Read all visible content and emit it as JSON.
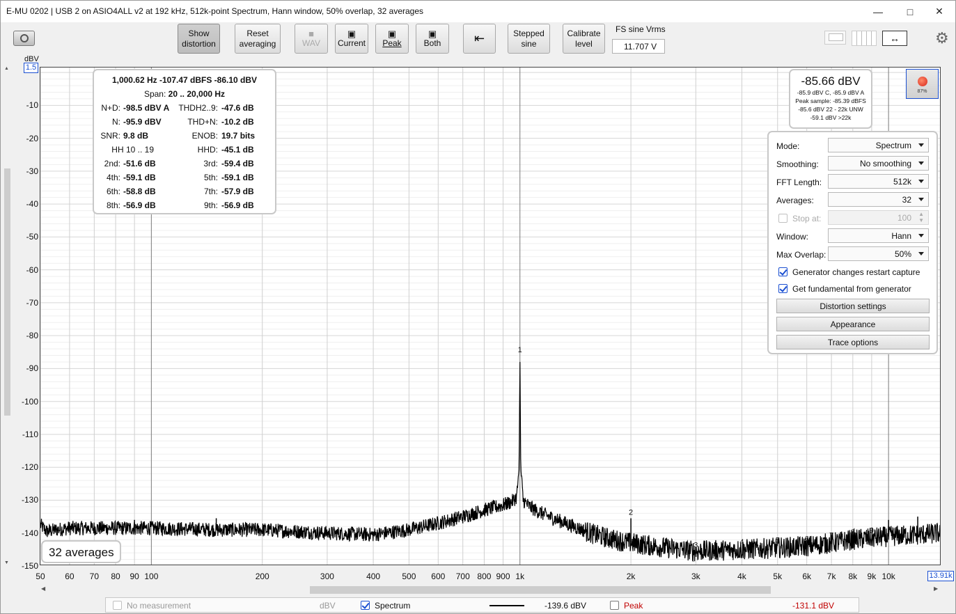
{
  "window": {
    "title": "E-MU 0202 | USB 2 on ASIO4ALL v2 at 192 kHz, 512k-point Spectrum, Hann window, 50% overlap, 32 averages",
    "minimize_icon": "minimize-icon",
    "maximize_icon": "maximize-icon",
    "close_icon": "close-icon"
  },
  "toolbar": {
    "snapshot_icon": "camera-icon",
    "show_distortion": [
      "Show",
      "distortion"
    ],
    "reset_averaging": [
      "Reset",
      "averaging"
    ],
    "wav": "WAV",
    "current": "Current",
    "peak": "Peak",
    "both": "Both",
    "export_icon": "export-arrow-icon",
    "stepped_sine": [
      "Stepped",
      "sine"
    ],
    "calibrate_level": [
      "Calibrate",
      "level"
    ],
    "fs_label": "FS sine Vrms",
    "fs_value": "11.707 V",
    "gear_icon": "gear-icon"
  },
  "plot": {
    "ylabel": "dBV",
    "y_top_value": "1.5",
    "y_ticks": [
      "-10",
      "-20",
      "-30",
      "-40",
      "-50",
      "-60",
      "-70",
      "-80",
      "-90",
      "-100",
      "-110",
      "-120",
      "-130",
      "-140",
      "-150"
    ],
    "x_ticks": [
      "50",
      "60",
      "70",
      "80",
      "90",
      "100",
      "200",
      "300",
      "400",
      "500",
      "600",
      "700",
      "800",
      "900",
      "1k",
      "2k",
      "3k",
      "4k",
      "5k",
      "6k",
      "7k",
      "8k",
      "9k",
      "10k"
    ],
    "x_end_value": "13.91k",
    "averages_badge": "32 averages"
  },
  "chart_data": {
    "type": "line",
    "xlabel": "",
    "ylabel": "dBV",
    "xscale": "log",
    "xlim": [
      50,
      13910
    ],
    "ylim": [
      -150,
      1.5
    ],
    "grid": true,
    "series": [
      {
        "name": "Spectrum",
        "color": "#000000",
        "x": [
          50,
          52,
          55,
          60,
          70,
          80,
          100,
          150,
          200,
          300,
          400,
          500,
          600,
          700,
          800,
          900,
          950,
          980,
          995,
          1000,
          1005,
          1020,
          1050,
          1100,
          1200,
          1400,
          1600,
          1800,
          2000,
          2500,
          3000,
          4000,
          5000,
          6000,
          7000,
          8000,
          9000,
          10000,
          12000,
          13910
        ],
        "y": [
          -137.5,
          -139.5,
          -139,
          -138.5,
          -138.5,
          -138.5,
          -138.5,
          -139,
          -139,
          -140,
          -140.5,
          -139,
          -137,
          -135,
          -133,
          -131.5,
          -130.5,
          -129,
          -120,
          -86.1,
          -120,
          -130,
          -131.5,
          -133,
          -135,
          -138,
          -140.5,
          -142,
          -143,
          -144.5,
          -145.5,
          -145,
          -144.5,
          -144,
          -143,
          -142,
          -141.5,
          -141,
          -140.5,
          -140
        ]
      }
    ],
    "harmonic_markers": [
      {
        "label": "1",
        "x": 1000,
        "y": -86.1
      },
      {
        "label": "2",
        "x": 2000,
        "y": -135.5
      },
      {
        "label": "3",
        "x": 3000,
        "y": -145.5
      },
      {
        "label": "4",
        "x": 4000,
        "y": -144.5
      },
      {
        "label": "5",
        "x": 5000,
        "y": -144
      },
      {
        "label": "6",
        "x": 6000,
        "y": -143.5
      },
      {
        "label": "7",
        "x": 7000,
        "y": -142.5
      },
      {
        "label": "8",
        "x": 8000,
        "y": -141.5
      },
      {
        "label": "9",
        "x": 9000,
        "y": -141
      }
    ],
    "spurs": [
      {
        "x": 90,
        "y": -136
      },
      {
        "x": 150,
        "y": -135.5
      },
      {
        "x": 2000,
        "y": -135.5
      },
      {
        "x": 10000,
        "y": -136
      },
      {
        "x": 12000,
        "y": -135
      }
    ]
  },
  "distortion": {
    "header": "1,000.62 Hz  -107.47 dBFS  -86.10 dBV",
    "span_label": "Span:",
    "span_value": "20 .. 20,000 Hz",
    "rows": [
      {
        "l1": "N+D:",
        "v1": "-98.5 dBV A",
        "l2": "THDH2..9:",
        "v2": "-47.6 dB"
      },
      {
        "l1": "N:",
        "v1": "-95.9 dBV",
        "l2": "THD+N:",
        "v2": "-10.2 dB"
      },
      {
        "l1": "SNR:",
        "v1": "9.8 dB",
        "l2": "ENOB:",
        "v2": "19.7 bits"
      },
      {
        "l1": "HH 10 .. 19",
        "v1": "",
        "l2": "HHD:",
        "v2": "-45.1 dB"
      },
      {
        "l1": "2nd:",
        "v1": "-51.6 dB",
        "l2": "3rd:",
        "v2": "-59.4 dB"
      },
      {
        "l1": "4th:",
        "v1": "-59.1 dB",
        "l2": "5th:",
        "v2": "-59.1 dB"
      },
      {
        "l1": "6th:",
        "v1": "-58.8 dB",
        "l2": "7th:",
        "v2": "-57.9 dB"
      },
      {
        "l1": "8th:",
        "v1": "-56.9 dB",
        "l2": "9th:",
        "v2": "-56.9 dB"
      }
    ]
  },
  "level": {
    "big": "-85.66 dBV",
    "lines": [
      "-85.9 dBV C, -85.9 dBV A",
      "Peak sample: -85.39 dBFS",
      "-85.6 dBV 22 - 22k UNW",
      "-59.1 dBV >22k"
    ],
    "record_percent": "87%"
  },
  "settings": {
    "mode_label": "Mode:",
    "mode_value": "Spectrum",
    "smoothing_label": "Smoothing:",
    "smoothing_value": "No smoothing",
    "fft_label": "FFT Length:",
    "fft_value": "512k",
    "averages_label": "Averages:",
    "averages_value": "32",
    "stop_at_label": "Stop at:",
    "stop_at_value": "100",
    "window_label": "Window:",
    "window_value": "Hann",
    "overlap_label": "Max Overlap:",
    "overlap_value": "50%",
    "gen_restart": "Generator changes restart capture",
    "gen_fundamental": "Get fundamental from generator",
    "distortion_settings": "Distortion settings",
    "appearance": "Appearance",
    "trace_options": "Trace options"
  },
  "status": {
    "no_measurement": "No measurement",
    "unit": "dBV",
    "spectrum_label": "Spectrum",
    "spectrum_value": "-139.6 dBV",
    "peak_label": "Peak",
    "peak_value": "-131.1 dBV",
    "peak_color": "#c00000"
  }
}
